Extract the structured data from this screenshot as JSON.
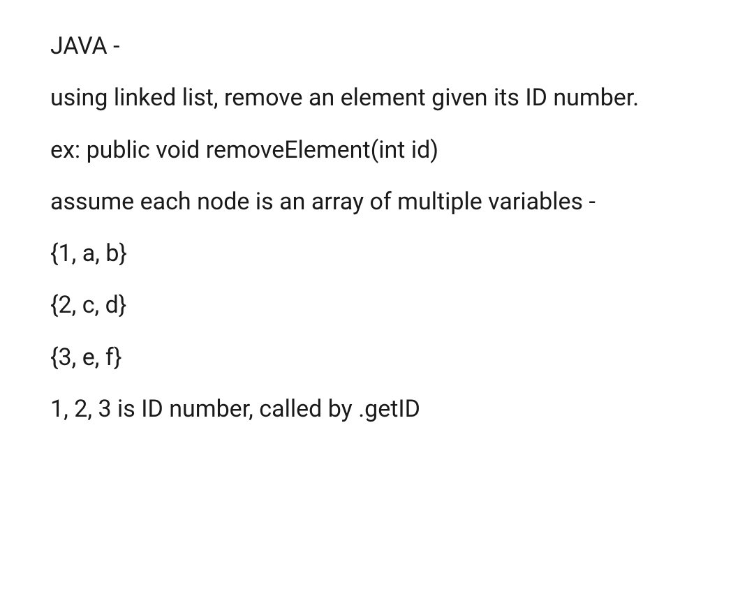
{
  "lines": {
    "title": "JAVA -",
    "desc1": "using linked list, remove an element given its ID number.",
    "example": "ex: public void removeElement(int id)",
    "assume": "assume each node is an array of multiple variables -",
    "node1": "{1, a, b}",
    "node2": "{2, c, d}",
    "node3": "{3, e, f}",
    "footer": "1, 2, 3 is ID number, called by .getID"
  }
}
